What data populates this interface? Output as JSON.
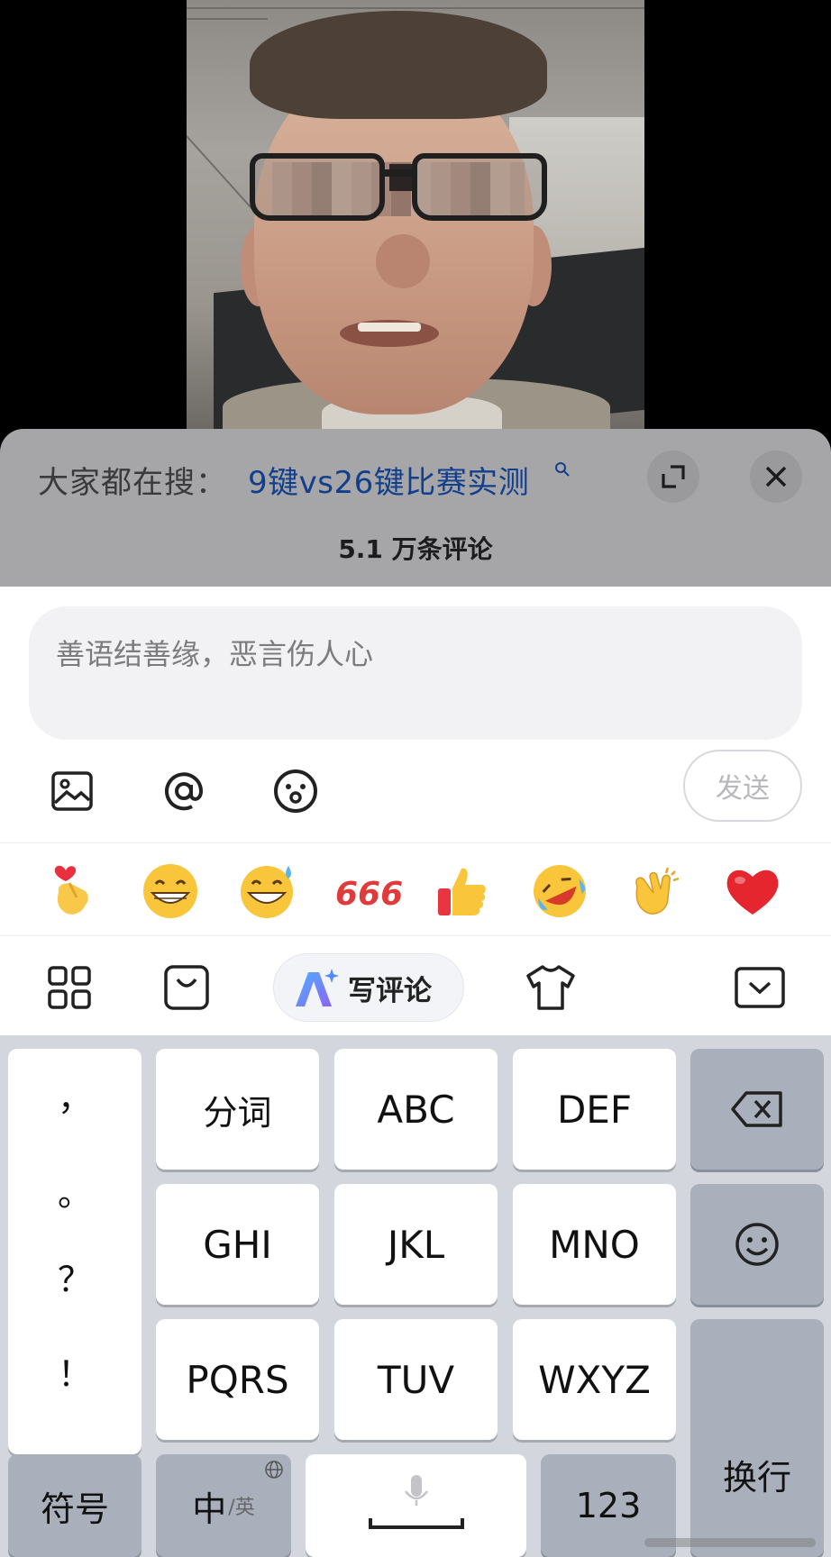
{
  "header": {
    "search_prefix": "大家都在搜：",
    "search_link": "9键vs26键比赛实测",
    "comment_count": "5.1 万条评论"
  },
  "input": {
    "placeholder": "善语结善缘，恶言伤人心",
    "send_label": "发送"
  },
  "emoji_row": [
    "finger-heart",
    "grin",
    "sweat-grin",
    "666",
    "thumbs-up",
    "rolling-laugh",
    "clap",
    "red-heart"
  ],
  "emoji_text": {
    "six": "666"
  },
  "toolbar": {
    "write_comment_label": "写评论"
  },
  "keyboard": {
    "punctuation": [
      "，",
      "。",
      "？",
      "！"
    ],
    "row1": [
      "分词",
      "ABC",
      "DEF"
    ],
    "row2": [
      "GHI",
      "JKL",
      "MNO"
    ],
    "row3": [
      "PQRS",
      "TUV",
      "WXYZ"
    ],
    "symbols_label": "符号",
    "lang_main": "中",
    "lang_sub": "/英",
    "numbers_label": "123",
    "enter_label": "换行"
  },
  "colors": {
    "search_link": "#123f8c",
    "keyboard_bg": "#d3d6dd",
    "gray_key": "#a9b0bc",
    "heart": "#e5262e"
  }
}
